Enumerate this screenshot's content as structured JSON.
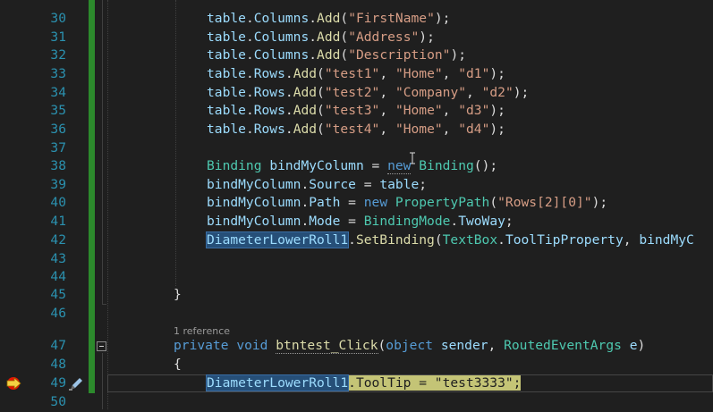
{
  "editor": {
    "lines": [
      {
        "num": "30",
        "tokens": [
          [
            "v",
            "table"
          ],
          [
            "w",
            "."
          ],
          [
            "v",
            "Columns"
          ],
          [
            "w",
            "."
          ],
          [
            "m",
            "Add"
          ],
          [
            "w",
            "("
          ],
          [
            "s",
            "\"FirstName\""
          ],
          [
            "w",
            ");"
          ]
        ]
      },
      {
        "num": "31",
        "tokens": [
          [
            "v",
            "table"
          ],
          [
            "w",
            "."
          ],
          [
            "v",
            "Columns"
          ],
          [
            "w",
            "."
          ],
          [
            "m",
            "Add"
          ],
          [
            "w",
            "("
          ],
          [
            "s",
            "\"Address\""
          ],
          [
            "w",
            ");"
          ]
        ]
      },
      {
        "num": "32",
        "tokens": [
          [
            "v",
            "table"
          ],
          [
            "w",
            "."
          ],
          [
            "v",
            "Columns"
          ],
          [
            "w",
            "."
          ],
          [
            "m",
            "Add"
          ],
          [
            "w",
            "("
          ],
          [
            "s",
            "\"Description\""
          ],
          [
            "w",
            ");"
          ]
        ]
      },
      {
        "num": "33",
        "tokens": [
          [
            "v",
            "table"
          ],
          [
            "w",
            "."
          ],
          [
            "v",
            "Rows"
          ],
          [
            "w",
            "."
          ],
          [
            "m",
            "Add"
          ],
          [
            "w",
            "("
          ],
          [
            "s",
            "\"test1\""
          ],
          [
            "w",
            ", "
          ],
          [
            "s",
            "\"Home\""
          ],
          [
            "w",
            ", "
          ],
          [
            "s",
            "\"d1\""
          ],
          [
            "w",
            ");"
          ]
        ]
      },
      {
        "num": "34",
        "tokens": [
          [
            "v",
            "table"
          ],
          [
            "w",
            "."
          ],
          [
            "v",
            "Rows"
          ],
          [
            "w",
            "."
          ],
          [
            "m",
            "Add"
          ],
          [
            "w",
            "("
          ],
          [
            "s",
            "\"test2\""
          ],
          [
            "w",
            ", "
          ],
          [
            "s",
            "\"Company\""
          ],
          [
            "w",
            ", "
          ],
          [
            "s",
            "\"d2\""
          ],
          [
            "w",
            ");"
          ]
        ]
      },
      {
        "num": "35",
        "tokens": [
          [
            "v",
            "table"
          ],
          [
            "w",
            "."
          ],
          [
            "v",
            "Rows"
          ],
          [
            "w",
            "."
          ],
          [
            "m",
            "Add"
          ],
          [
            "w",
            "("
          ],
          [
            "s",
            "\"test3\""
          ],
          [
            "w",
            ", "
          ],
          [
            "s",
            "\"Home\""
          ],
          [
            "w",
            ", "
          ],
          [
            "s",
            "\"d3\""
          ],
          [
            "w",
            ");"
          ]
        ]
      },
      {
        "num": "36",
        "tokens": [
          [
            "v",
            "table"
          ],
          [
            "w",
            "."
          ],
          [
            "v",
            "Rows"
          ],
          [
            "w",
            "."
          ],
          [
            "m",
            "Add"
          ],
          [
            "w",
            "("
          ],
          [
            "s",
            "\"test4\""
          ],
          [
            "w",
            ", "
          ],
          [
            "s",
            "\"Home\""
          ],
          [
            "w",
            ", "
          ],
          [
            "s",
            "\"d4\""
          ],
          [
            "w",
            ");"
          ]
        ]
      },
      {
        "num": "37",
        "tokens": []
      },
      {
        "num": "38",
        "tokens": [
          [
            "t",
            "Binding"
          ],
          [
            "w",
            " "
          ],
          [
            "v",
            "bindMyColumn"
          ],
          [
            "w",
            " = "
          ],
          [
            "k",
            "new"
          ],
          [
            "w",
            " "
          ],
          [
            "t",
            "Binding"
          ],
          [
            "w",
            "();"
          ]
        ]
      },
      {
        "num": "39",
        "tokens": [
          [
            "v",
            "bindMyColumn"
          ],
          [
            "w",
            "."
          ],
          [
            "v",
            "Source"
          ],
          [
            "w",
            " = "
          ],
          [
            "v",
            "table"
          ],
          [
            "w",
            ";"
          ]
        ]
      },
      {
        "num": "40",
        "tokens": [
          [
            "v",
            "bindMyColumn"
          ],
          [
            "w",
            "."
          ],
          [
            "v",
            "Path"
          ],
          [
            "w",
            " = "
          ],
          [
            "k",
            "new"
          ],
          [
            "w",
            " "
          ],
          [
            "t",
            "PropertyPath"
          ],
          [
            "w",
            "("
          ],
          [
            "s",
            "\"Rows[2][0]\""
          ],
          [
            "w",
            ");"
          ]
        ]
      },
      {
        "num": "41",
        "tokens": [
          [
            "v",
            "bindMyColumn"
          ],
          [
            "w",
            "."
          ],
          [
            "v",
            "Mode"
          ],
          [
            "w",
            " = "
          ],
          [
            "t",
            "BindingMode"
          ],
          [
            "w",
            "."
          ],
          [
            "v",
            "TwoWay"
          ],
          [
            "w",
            ";"
          ]
        ]
      },
      {
        "num": "42",
        "tokens": [
          [
            "vh",
            "DiameterLowerRoll1"
          ],
          [
            "w",
            "."
          ],
          [
            "m",
            "SetBinding"
          ],
          [
            "w",
            "("
          ],
          [
            "t",
            "TextBox"
          ],
          [
            "w",
            "."
          ],
          [
            "v",
            "ToolTipProperty"
          ],
          [
            "w",
            ", "
          ],
          [
            "v",
            "bindMyC"
          ]
        ]
      },
      {
        "num": "43",
        "tokens": []
      },
      {
        "num": "44",
        "tokens": []
      },
      {
        "num": "45",
        "tokens": [
          [
            "w",
            "}"
          ]
        ]
      },
      {
        "num": "46",
        "tokens": []
      },
      {
        "num": "47",
        "tokens": [
          [
            "k",
            "private"
          ],
          [
            "w",
            " "
          ],
          [
            "k",
            "void"
          ],
          [
            "w",
            " "
          ],
          [
            "m",
            "btntest_Click"
          ],
          [
            "w",
            "("
          ],
          [
            "k",
            "object"
          ],
          [
            "w",
            " "
          ],
          [
            "v",
            "sender"
          ],
          [
            "w",
            ", "
          ],
          [
            "t",
            "RoutedEventArgs"
          ],
          [
            "w",
            " "
          ],
          [
            "v",
            "e"
          ],
          [
            "w",
            ")"
          ]
        ]
      },
      {
        "num": "48",
        "tokens": [
          [
            "w",
            "{"
          ]
        ]
      },
      {
        "num": "49",
        "tokens": [
          [
            "vh",
            "DiameterLowerRoll1"
          ],
          [
            "y",
            ".ToolTip = \"test3333\";"
          ]
        ]
      },
      {
        "num": "50",
        "tokens": []
      }
    ],
    "codelens": "1 reference"
  }
}
